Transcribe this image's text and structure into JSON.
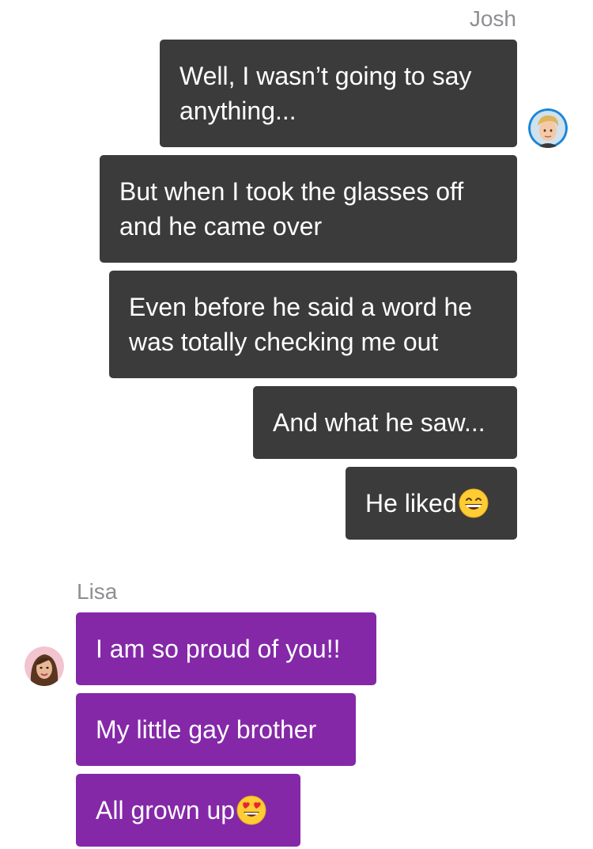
{
  "conversation": {
    "josh": {
      "sender_name": "Josh",
      "messages": [
        {
          "text": "Well, I wasn’t going to say anything..."
        },
        {
          "text": "But when I took the glasses off and he came over"
        },
        {
          "text": "Even before he said a word he was totally checking me out"
        },
        {
          "text": "And what he saw..."
        },
        {
          "text": "He liked",
          "emoji": "grinning-face-emoji"
        }
      ],
      "bubble_color": "#3b3b3b"
    },
    "lisa": {
      "sender_name": "Lisa",
      "messages": [
        {
          "text": "I am so proud of you!!"
        },
        {
          "text": "My little gay brother"
        },
        {
          "text": "All grown up",
          "emoji": "heart-eyes-emoji"
        }
      ],
      "bubble_color": "#8428a8"
    }
  }
}
